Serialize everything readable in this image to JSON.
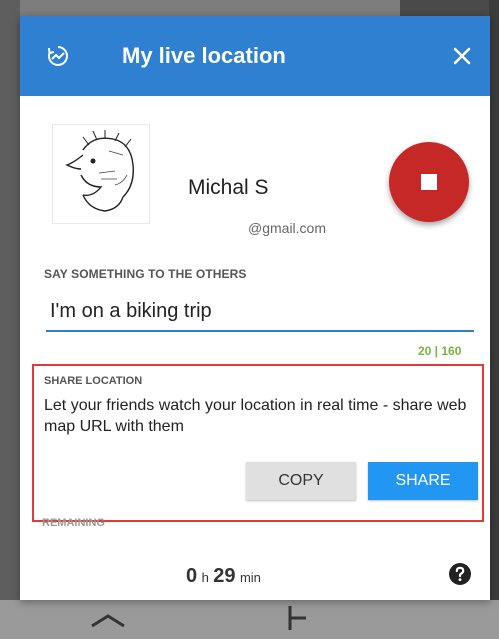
{
  "dialog": {
    "title": "My live location",
    "icons": {
      "header": "live-location-icon",
      "close": "close-icon",
      "stop": "stop-icon",
      "help": "help-icon"
    },
    "accent_color": "#2f80d1"
  },
  "user": {
    "name": "Michal S",
    "email": "@gmail.com"
  },
  "message": {
    "label": "SAY SOMETHING TO THE OTHERS",
    "value": "I'm on a biking trip",
    "counter": "20 | 160"
  },
  "share": {
    "label": "SHARE LOCATION",
    "description": "Let your friends watch your location in real time - share web map URL with them",
    "copy_label": "COPY",
    "share_label": "SHARE",
    "highlight_color": "#e53935"
  },
  "remaining": {
    "label": "REMAINING",
    "hours": "0",
    "hours_unit": "h",
    "minutes": "29",
    "minutes_unit": "min"
  }
}
